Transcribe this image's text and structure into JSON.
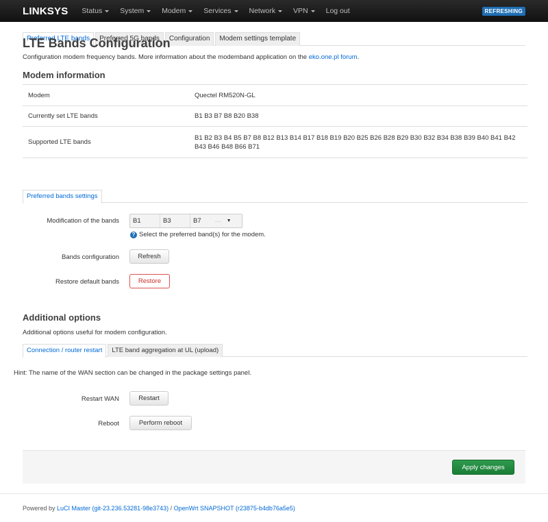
{
  "topbar": {
    "brand": "LINKSYS",
    "menu": [
      "Status",
      "System",
      "Modem",
      "Services",
      "Network",
      "VPN",
      "Log out"
    ],
    "badge": "REFRESHING"
  },
  "tabs": [
    "Preferred LTE bands",
    "Preferred 5G bands",
    "Configuration",
    "Modem settings template"
  ],
  "page": {
    "title": "LTE Bands Configuration",
    "desc_prefix": "Configuration modem frequency bands. More information about the modemband application on the ",
    "desc_link": "eko.one.pl forum",
    "desc_suffix": "."
  },
  "modem_info": {
    "title": "Modem information",
    "rows": [
      {
        "label": "Modem",
        "value": "Quectel RM520N-GL"
      },
      {
        "label": "Currently set LTE bands",
        "value": "B1 B3 B7 B8 B20 B38"
      },
      {
        "label": "Supported LTE bands",
        "value": "B1 B2 B3 B4 B5 B7 B8 B12 B13 B14 B17 B18 B19 B20 B25 B26 B28 B29 B30 B32 B34 B38 B39 B40 B41 B42 B43 B46 B48 B66 B71"
      }
    ]
  },
  "preferred": {
    "tab": "Preferred bands settings",
    "modification_label": "Modification of the bands",
    "selected_bands": [
      "B1",
      "B3",
      "B7"
    ],
    "more": "···",
    "hint": "Select the preferred band(s) for the modem.",
    "bands_config_label": "Bands configuration",
    "refresh_label": "Refresh",
    "restore_label_row": "Restore default bands",
    "restore_label": "Restore"
  },
  "additional": {
    "title": "Additional options",
    "desc": "Additional options useful for modem configuration.",
    "tabs": [
      "Connection / router restart",
      "LTE band aggregation at UL (upload)"
    ],
    "hint": "Hint: The name of the WAN section can be changed in the package settings panel.",
    "restart_wan_label": "Restart WAN",
    "restart_button": "Restart",
    "reboot_label": "Reboot",
    "reboot_button": "Perform reboot"
  },
  "apply_label": "Apply changes",
  "footer": {
    "prefix": "Powered by ",
    "luci": "LuCI Master (git-23.236.53281-98e3743)",
    "sep": " / ",
    "openwrt": "OpenWrt SNAPSHOT (r23875-b4db76a5e5)"
  },
  "colors": {
    "accent": "#0069d6",
    "apply": "#1a7d36",
    "danger": "#c9302c",
    "badge": "#1f6fb5"
  }
}
